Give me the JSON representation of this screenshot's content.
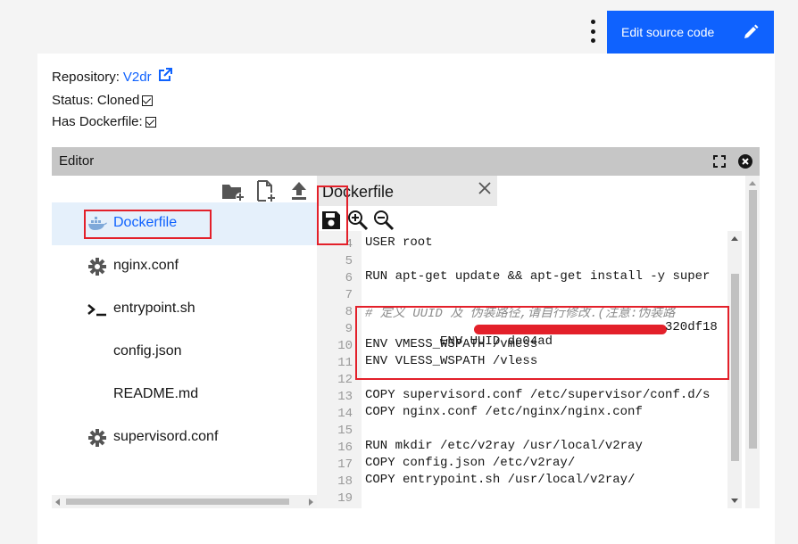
{
  "header": {
    "edit_button_label": "Edit source code",
    "edit_icon": "pencil-icon",
    "menu_icon": "overflow-menu-icon"
  },
  "info": {
    "repository_label": "Repository:",
    "repository_link": "V2dr",
    "status_label": "Status: Cloned",
    "status_checked": true,
    "dockerfile_label": "Has Dockerfile:",
    "dockerfile_checked": true
  },
  "editor": {
    "title": "Editor",
    "file_tree": {
      "toolbar_icons": [
        "new-folder-icon",
        "new-file-icon",
        "upload-icon"
      ],
      "items": [
        {
          "label": "Dockerfile",
          "icon": "docker-icon",
          "active": true
        },
        {
          "label": "nginx.conf",
          "icon": "gear-icon"
        },
        {
          "label": "entrypoint.sh",
          "icon": "terminal-icon"
        },
        {
          "label": "config.json",
          "icon": ""
        },
        {
          "label": "README.md",
          "icon": ""
        },
        {
          "label": "supervisord.conf",
          "icon": "gear-icon"
        }
      ]
    },
    "tab": {
      "label": "Dockerfile"
    },
    "toolbar_icons": [
      "save-icon",
      "zoom-in-icon",
      "zoom-out-icon"
    ],
    "lines": [
      {
        "n": "4",
        "text": "USER root"
      },
      {
        "n": "5",
        "text": ""
      },
      {
        "n": "6",
        "text": "RUN apt-get update && apt-get install -y super"
      },
      {
        "n": "7",
        "text": ""
      },
      {
        "n": "8",
        "text": "# 定义 UUID 及 伪装路径,请自行修改.(注意:伪装路",
        "comment": true
      },
      {
        "n": "9",
        "text": "ENV UUID de04ad",
        "tail": "320df18",
        "redacted": true
      },
      {
        "n": "10",
        "text": "ENV VMESS_WSPATH /vmess"
      },
      {
        "n": "11",
        "text": "ENV VLESS_WSPATH /vless"
      },
      {
        "n": "12",
        "text": ""
      },
      {
        "n": "13",
        "text": "COPY supervisord.conf /etc/supervisor/conf.d/s"
      },
      {
        "n": "14",
        "text": "COPY nginx.conf /etc/nginx/nginx.conf"
      },
      {
        "n": "15",
        "text": ""
      },
      {
        "n": "16",
        "text": "RUN mkdir /etc/v2ray /usr/local/v2ray"
      },
      {
        "n": "17",
        "text": "COPY config.json /etc/v2ray/"
      },
      {
        "n": "18",
        "text": "COPY entrypoint.sh /usr/local/v2ray/"
      },
      {
        "n": "19",
        "text": ""
      }
    ]
  },
  "colors": {
    "accent": "#0f62fe",
    "highlight": "#e3202a"
  }
}
